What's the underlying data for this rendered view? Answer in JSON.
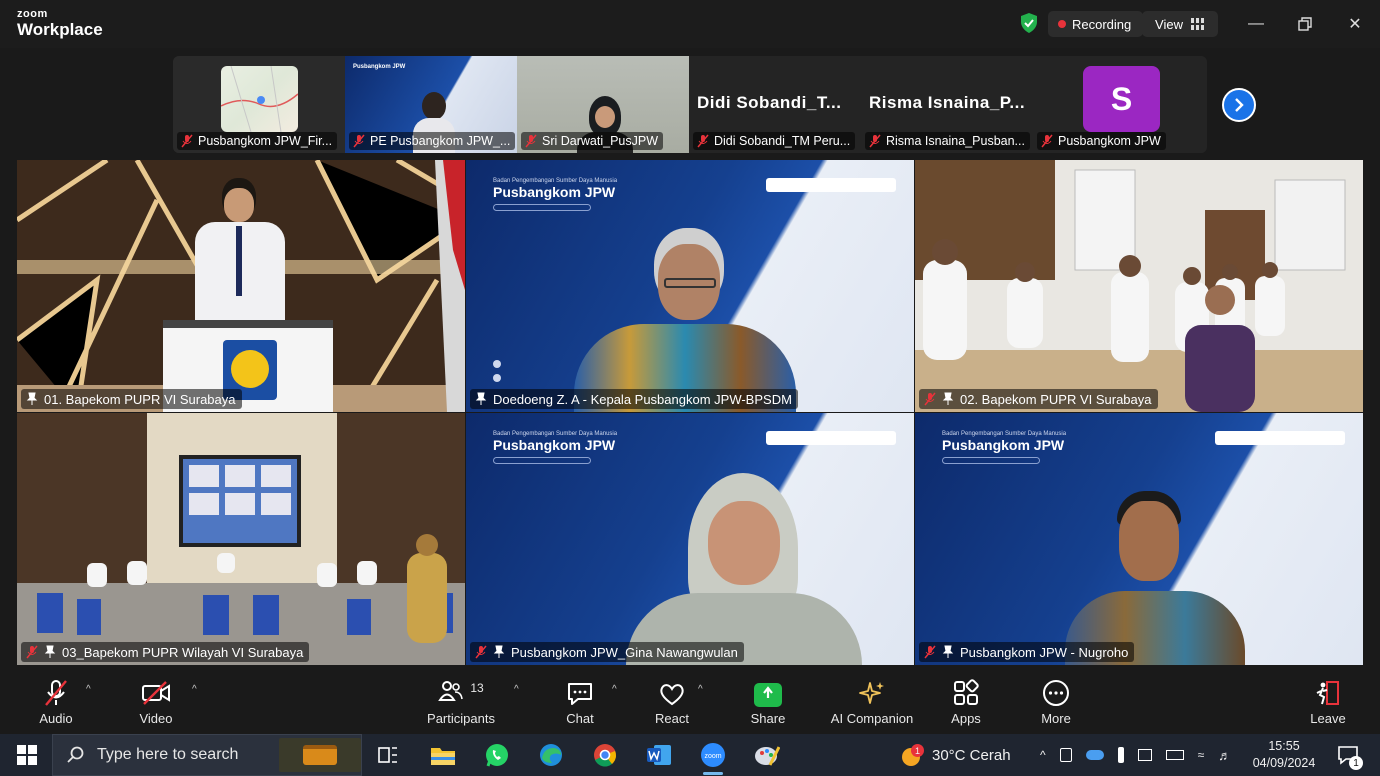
{
  "titlebar": {
    "brand_small": "zoom",
    "brand_large": "Workplace",
    "recording_label": "Recording",
    "view_label": "View"
  },
  "strip": [
    {
      "name": "Pusbangkom JPW_Fir...",
      "muted": true
    },
    {
      "name": "PE Pusbangkom JPW_...",
      "muted": true
    },
    {
      "name": "Sri Darwati_PusJPW",
      "muted": true
    },
    {
      "name": "Didi Sobandi_TM Peru...",
      "big_name": "Didi  Sobandi_T...",
      "muted": true
    },
    {
      "name": "Risma Isnaina_Pusban...",
      "big_name": "Risma  Isnaina_P...",
      "muted": true
    },
    {
      "name": "Pusbangkom JPW",
      "avatar_letter": "S",
      "avatar_color": "#9b27c2",
      "muted": true
    }
  ],
  "banner_text": {
    "small": "Badan Pengembangan Sumber Daya Manusia",
    "title": "Pusbangkom JPW"
  },
  "grid": [
    {
      "name": "01. Bapekom PUPR VI Surabaya",
      "active": true
    },
    {
      "name": "Doedoeng Z. A - Kepala Pusbangkom JPW-BPSDM"
    },
    {
      "name": "02. Bapekom PUPR VI Surabaya"
    },
    {
      "name": "03_Bapekom PUPR Wilayah VI Surabaya"
    },
    {
      "name": "Pusbangkom JPW_Gina Nawangwulan"
    },
    {
      "name": "Pusbangkom JPW - Nugroho"
    }
  ],
  "toolbar": {
    "audio": "Audio",
    "video": "Video",
    "participants": "Participants",
    "participant_count": "13",
    "chat": "Chat",
    "react": "React",
    "share": "Share",
    "ai_companion": "AI Companion",
    "apps": "Apps",
    "more": "More",
    "leave": "Leave"
  },
  "taskbar": {
    "search_placeholder": "Type here to search",
    "weather": "30°C  Cerah",
    "weather_badge": "1",
    "time": "15:55",
    "date": "04/09/2024",
    "notification_count": "1"
  },
  "colors": {
    "active_speaker": "#2bd46c",
    "recording_dot": "#e8333b",
    "share_green": "#1fbb4b",
    "next_blue": "#1a73e8"
  }
}
